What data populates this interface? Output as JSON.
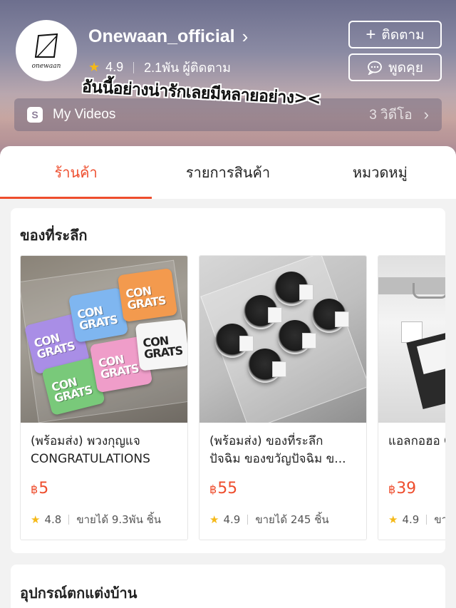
{
  "shop": {
    "name": "Onewaan_official",
    "avatar_text": "onewaan",
    "rating": "4.9",
    "followers": "2.1พัน ผู้ติดตาม",
    "follow_label": "ติดตาม",
    "chat_label": "พูดคุย"
  },
  "videos": {
    "label": "My Videos",
    "count": "3 วิดีโอ"
  },
  "caption": "อันนี้อย่างน่ารักเลยมีหลายอย่าง><",
  "tabs": [
    {
      "label": "ร้านค้า",
      "active": true
    },
    {
      "label": "รายการสินค้า",
      "active": false
    },
    {
      "label": "หมวดหมู่",
      "active": false
    }
  ],
  "sections": [
    {
      "title": "ของที่ระลึก",
      "products": [
        {
          "name": "(พร้อมส่ง) พวงกุญแจ CONGRATULATIONS",
          "currency": "฿",
          "price": "5",
          "rating": "4.8",
          "sold": "ขายได้ 9.3พัน ชิ้น"
        },
        {
          "name": "(พร้อมส่ง) ของที่ระลึก ปัจฉิม ของขวัญปัจฉิม ข...",
          "currency": "฿",
          "price": "55",
          "rating": "4.9",
          "sold": "ขายได้ 245 ชิ้น"
        },
        {
          "name": "แอลกอฮอ CONGRA",
          "currency": "฿",
          "price": "39",
          "rating": "4.9",
          "sold": "ขาย"
        }
      ]
    },
    {
      "title": "อุปกรณ์ตกแต่งบ้าน"
    }
  ],
  "colors": {
    "accent": "#ee4d2d",
    "star": "#f5b918"
  },
  "icons": {
    "star": "star-icon",
    "chevron": "chevron-right-icon",
    "plus": "plus-icon",
    "chat": "chat-bubble-icon",
    "videos": "video-icon"
  }
}
